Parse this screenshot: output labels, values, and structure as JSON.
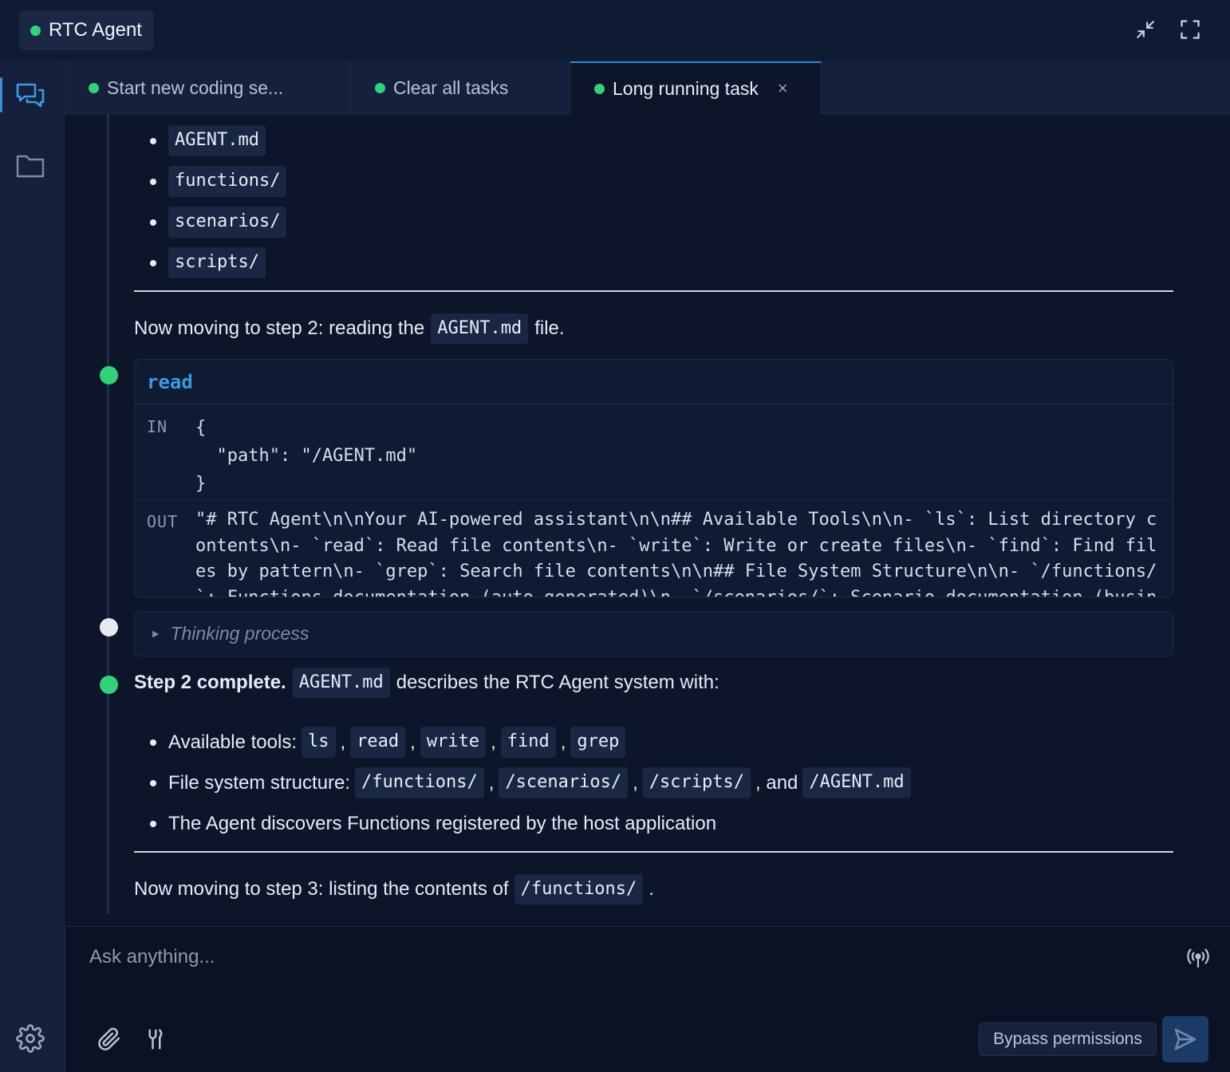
{
  "header": {
    "app_title": "RTC Agent"
  },
  "tabs": [
    {
      "label": "Start new coding se..."
    },
    {
      "label": "Clear all tasks"
    },
    {
      "label": "Long running task",
      "close": "×"
    }
  ],
  "content": {
    "file_list": [
      "AGENT.md",
      "functions/",
      "scenarios/",
      "scripts/"
    ],
    "step2_intro": {
      "before": "Now moving to step 2: reading the",
      "code": "AGENT.md",
      "after": "file."
    },
    "tool": {
      "name": "read",
      "in_label": "IN",
      "in_code": "{\n  \"path\": \"/AGENT.md\"\n}",
      "out_label": "OUT",
      "out_text": "\"# RTC Agent\\n\\nYour AI-powered assistant\\n\\n## Available Tools\\n\\n- `ls`: List directory contents\\n- `read`: Read file contents\\n- `write`: Write or create files\\n- `find`: Find files by pattern\\n- `grep`: Search file contents\\n\\n## File System Structure\\n\\n- `/functions/`: Functions documentation (auto-generated)\\n- `/scenarios/`: Scenario documentation (business workflows"
    },
    "thinking_label": "Thinking process",
    "step2_complete": {
      "bold": "Step 2 complete.",
      "code": "AGENT.md",
      "after": "describes the RTC Agent system with:"
    },
    "details": {
      "tools_label": "Available tools:",
      "tools": [
        "ls",
        "read",
        "write",
        "find",
        "grep"
      ],
      "fs_label": "File system structure:",
      "fs": [
        "/functions/",
        "/scenarios/",
        "/scripts/"
      ],
      "fs_and": ", and",
      "fs_last": "/AGENT.md",
      "discover": "The Agent discovers Functions registered by the host application"
    },
    "step3_intro": {
      "before": "Now moving to step 3: listing the contents of",
      "code": "/functions/",
      "after": "."
    }
  },
  "input": {
    "placeholder": "Ask anything...",
    "bypass_label": "Bypass permissions"
  },
  "colors": {
    "accent": "#3b8ed6",
    "success": "#34d17c",
    "background": "#0c1529"
  }
}
